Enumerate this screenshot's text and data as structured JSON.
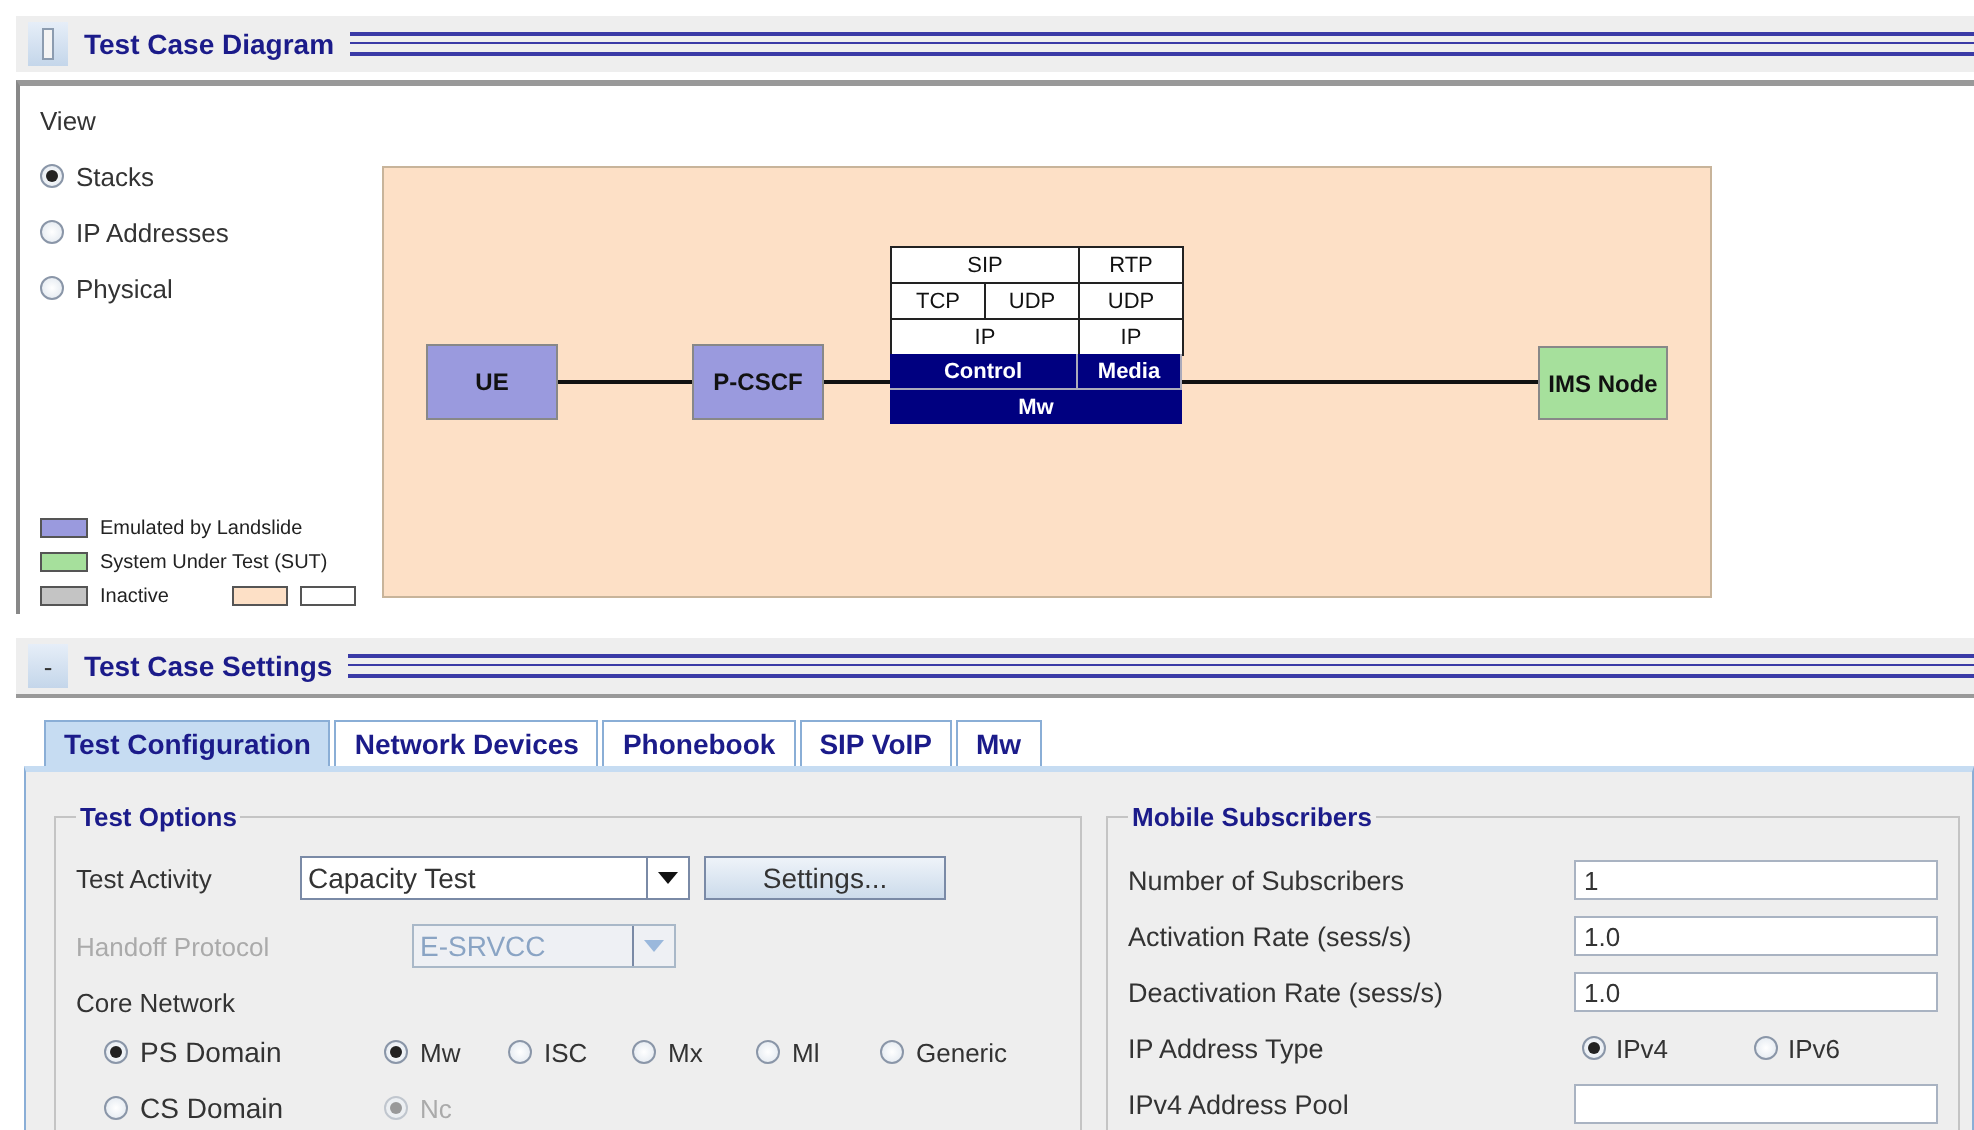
{
  "diagram_panel": {
    "title": "Test Case Diagram"
  },
  "view": {
    "label": "View",
    "options": [
      {
        "label": "Stacks",
        "selected": true
      },
      {
        "label": "IP Addresses",
        "selected": false
      },
      {
        "label": "Physical",
        "selected": false
      }
    ]
  },
  "legend": [
    {
      "label": "Emulated by Landslide",
      "color": "#9a9ade"
    },
    {
      "label": "System Under Test (SUT)",
      "color": "#a6e09c"
    },
    {
      "label": "Inactive",
      "color": "#c4c4c4"
    }
  ],
  "legend_swatches": [
    {
      "color": "#fde0c6"
    },
    {
      "color": "#ffffff"
    }
  ],
  "diagram": {
    "nodes": [
      {
        "label": "UE",
        "kind": "emulated"
      },
      {
        "label": "P-CSCF",
        "kind": "emulated"
      },
      {
        "label": "IMS Node",
        "kind": "sut"
      }
    ],
    "stack": {
      "columns": [
        {
          "rows": [
            [
              "SIP"
            ],
            [
              "TCP",
              "UDP"
            ],
            [
              "IP"
            ]
          ],
          "plane": "Control"
        },
        {
          "rows": [
            [
              "RTP"
            ],
            [
              "UDP"
            ],
            [
              "IP"
            ]
          ],
          "plane": "Media"
        }
      ],
      "interface": "Mw"
    }
  },
  "settings_panel": {
    "title": "Test Case Settings",
    "toggle": "-"
  },
  "tabs": [
    {
      "label": "Test Configuration",
      "selected": true
    },
    {
      "label": "Network Devices",
      "selected": false
    },
    {
      "label": "Phonebook",
      "selected": false
    },
    {
      "label": "SIP VoIP",
      "selected": false
    },
    {
      "label": "Mw",
      "selected": false
    }
  ],
  "test_options": {
    "title": "Test Options",
    "test_activity": {
      "label": "Test Activity",
      "value": "Capacity Test",
      "button": "Settings..."
    },
    "handoff_protocol": {
      "label": "Handoff Protocol",
      "value": "E-SRVCC",
      "disabled": true
    },
    "core_network": {
      "label": "Core Network",
      "domains": [
        {
          "label": "PS Domain",
          "selected": true,
          "interfaces": [
            {
              "label": "Mw",
              "selected": true,
              "disabled": false
            },
            {
              "label": "ISC",
              "selected": false,
              "disabled": false
            },
            {
              "label": "Mx",
              "selected": false,
              "disabled": false
            },
            {
              "label": "Ml",
              "selected": false,
              "disabled": false
            },
            {
              "label": "Generic",
              "selected": false,
              "disabled": false
            }
          ]
        },
        {
          "label": "CS Domain",
          "selected": false,
          "interfaces": [
            {
              "label": "Nc",
              "selected": true,
              "disabled": true
            }
          ]
        }
      ]
    }
  },
  "mobile_subscribers": {
    "title": "Mobile Subscribers",
    "rows": [
      {
        "kind": "text",
        "label": "Number of Subscribers",
        "value": "1"
      },
      {
        "kind": "text",
        "label": "Activation Rate (sess/s)",
        "value": "1.0"
      },
      {
        "kind": "text",
        "label": "Deactivation Rate (sess/s)",
        "value": "1.0"
      },
      {
        "kind": "radio",
        "label": "IP Address Type",
        "options": [
          {
            "label": "IPv4",
            "selected": true
          },
          {
            "label": "IPv6",
            "selected": false
          }
        ]
      },
      {
        "kind": "text",
        "label": "IPv4 Address Pool"
      }
    ]
  }
}
